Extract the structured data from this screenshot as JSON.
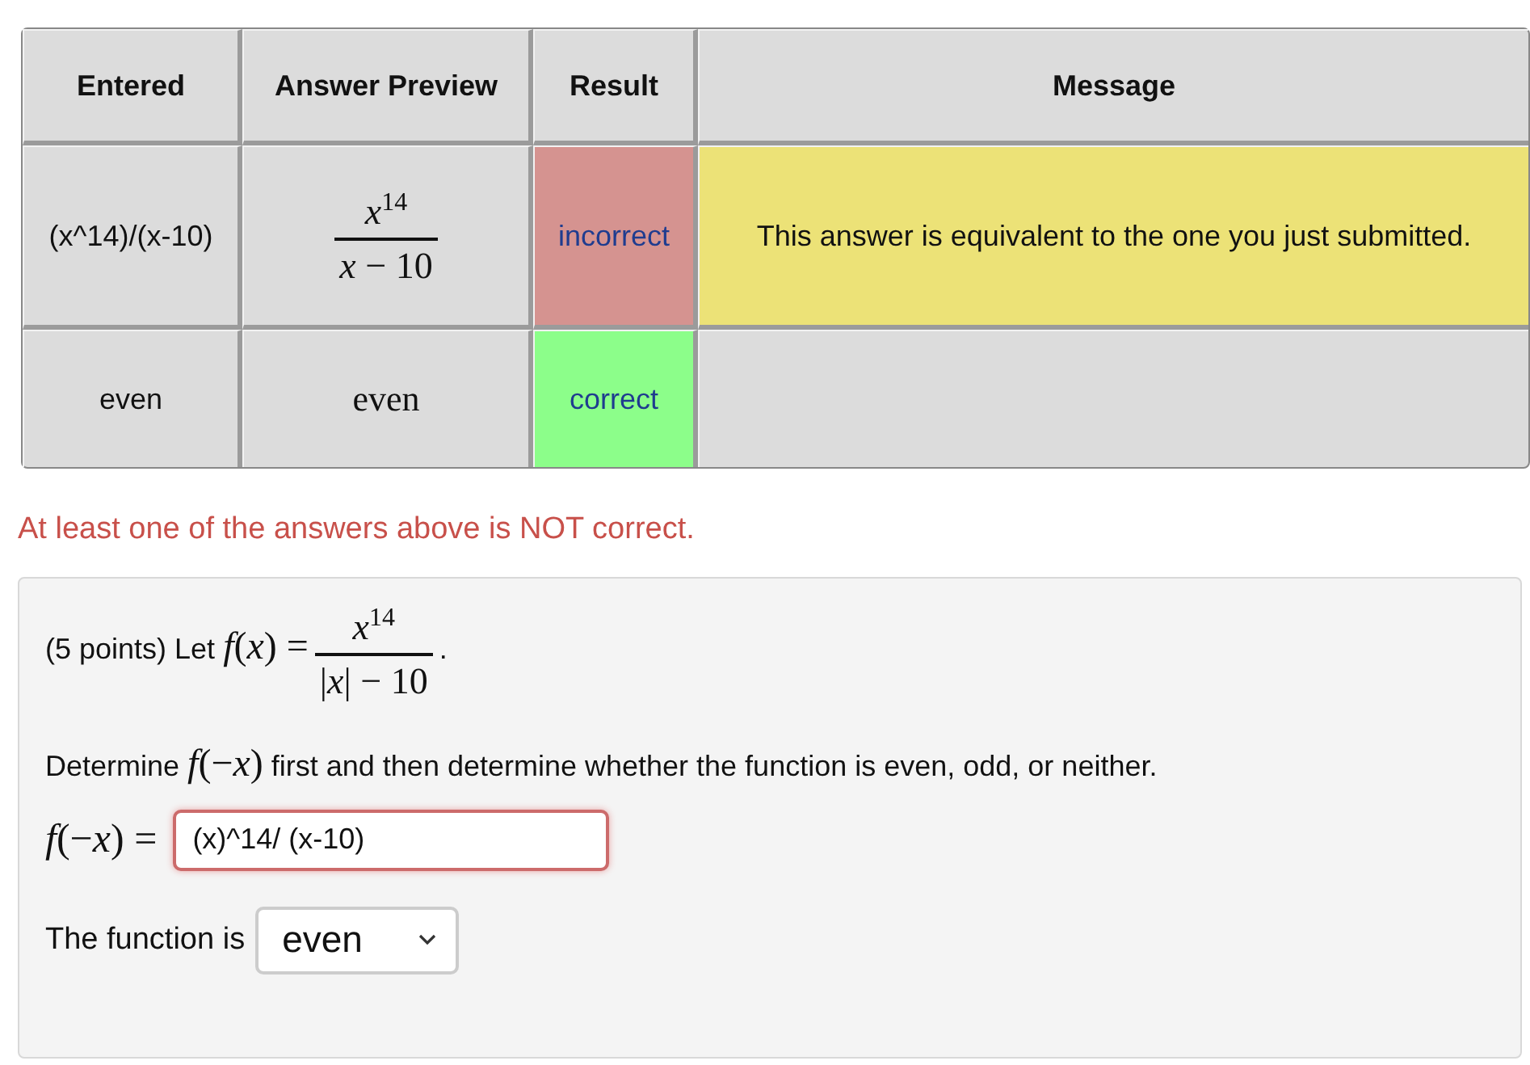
{
  "results_table": {
    "columns": [
      "Entered",
      "Answer Preview",
      "Result",
      "Message"
    ],
    "rows": [
      {
        "entered": "(x^14)/(x-10)",
        "preview": {
          "kind": "fraction",
          "numerator": "*x*$^{14}$",
          "denominator": "*x* − 10"
        },
        "result": "incorrect",
        "correct": false,
        "message": "This answer is equivalent to the one you just submitted."
      },
      {
        "entered": "even",
        "preview": {
          "kind": "text",
          "text": "even"
        },
        "result": "correct",
        "correct": true
      }
    ]
  },
  "status_message": "At least one of the answers above is NOT correct.",
  "problem": {
    "statement": [
      {
        "kind": "text",
        "text": "(5 points) Let "
      },
      {
        "kind": "math",
        "text": "*f*(*x*) ="
      },
      {
        "kind": "fraction",
        "numerator": "*x*$^{14}$",
        "denominator": "|*x*| − 10"
      },
      {
        "kind": "text",
        "text": "."
      }
    ],
    "instruction": [
      {
        "kind": "text",
        "text": "Determine "
      },
      {
        "kind": "math",
        "text": "*f*(−*x*)"
      },
      {
        "kind": "text",
        "text": " first and then determine whether the function is even, odd, or neither."
      }
    ],
    "answer": {
      "label": "*f*(−*x*) =",
      "value": "(x)^14/ (x-10)",
      "invalid": true
    },
    "choice": {
      "label": "The function is",
      "value": "even"
    }
  }
}
